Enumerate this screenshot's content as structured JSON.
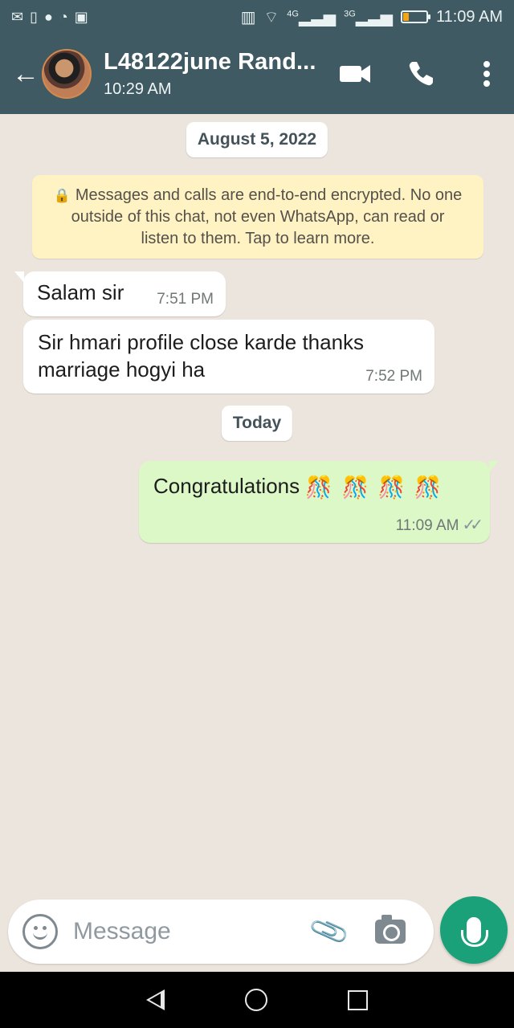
{
  "status_bar": {
    "time": "11:09 AM",
    "network_4g": "4G",
    "network_3g": "3G"
  },
  "header": {
    "title": "L48122june Rand...",
    "subtitle": "10:29 AM"
  },
  "chat": {
    "date_chips": [
      "August 5, 2022",
      "Today"
    ],
    "encryption_notice": "Messages and calls are end-to-end encrypted. No one outside of this chat, not even WhatsApp, can read or listen to them. Tap to learn more.",
    "messages": [
      {
        "direction": "incoming",
        "text": "Salam sir",
        "time": "7:51 PM"
      },
      {
        "direction": "incoming",
        "text": "Sir hmari profile close karde thanks marriage hogyi ha",
        "time": "7:52 PM"
      },
      {
        "direction": "outgoing",
        "text": "Congratulations",
        "emoji": "🎊 🎊 🎊 🎊",
        "time": "11:09 AM",
        "status": "read"
      }
    ]
  },
  "composer": {
    "placeholder": "Message"
  },
  "icons": [
    "back-arrow-icon",
    "video-call-icon",
    "phone-icon",
    "more-options-icon",
    "emoji-icon",
    "attachment-icon",
    "camera-icon",
    "microphone-icon"
  ],
  "colors": {
    "header": "#3f5a62",
    "outgoing_bubble": "#dcf8c6",
    "incoming_bubble": "#ffffff",
    "mic_button": "#1aa179",
    "notice_background": "#fff3c4"
  }
}
